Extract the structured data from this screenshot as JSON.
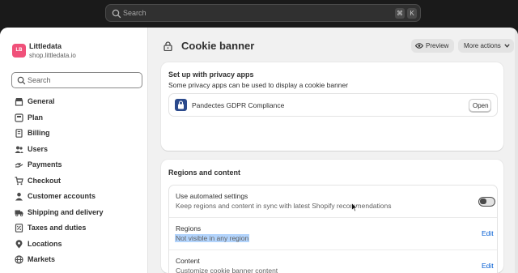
{
  "topbar": {
    "search_placeholder": "Search",
    "shortcut_keys": [
      "⌘",
      "K"
    ]
  },
  "store": {
    "initials": "LB",
    "name": "Littledata",
    "url": "shop.littledata.io",
    "avatar_color": "#f0517a"
  },
  "sidebar": {
    "search_placeholder": "Search",
    "items": [
      {
        "label": "General",
        "icon": "store-icon"
      },
      {
        "label": "Plan",
        "icon": "plan-icon"
      },
      {
        "label": "Billing",
        "icon": "billing-icon"
      },
      {
        "label": "Users",
        "icon": "users-icon"
      },
      {
        "label": "Payments",
        "icon": "payments-icon"
      },
      {
        "label": "Checkout",
        "icon": "checkout-icon"
      },
      {
        "label": "Customer accounts",
        "icon": "person-icon"
      },
      {
        "label": "Shipping and delivery",
        "icon": "truck-icon"
      },
      {
        "label": "Taxes and duties",
        "icon": "taxes-icon"
      },
      {
        "label": "Locations",
        "icon": "location-icon"
      },
      {
        "label": "Markets",
        "icon": "globe-icon"
      }
    ]
  },
  "page": {
    "title": "Cookie banner",
    "preview_label": "Preview",
    "more_actions_label": "More actions"
  },
  "privacy_card": {
    "title": "Set up with privacy apps",
    "subtitle": "Some privacy apps can be used to display a cookie banner",
    "app_name": "Pandectes GDPR Compliance",
    "open_label": "Open"
  },
  "regions_card": {
    "title": "Regions and content",
    "rows": [
      {
        "title": "Use automated settings",
        "subtitle": "Keep regions and content in sync with latest Shopify recommendations",
        "toggle_on": false
      },
      {
        "title": "Regions",
        "subtitle": "Not visible in any region",
        "action": "Edit"
      },
      {
        "title": "Content",
        "subtitle": "Customize cookie banner content",
        "action": "Edit"
      }
    ]
  },
  "colors": {
    "link": "#005bd3",
    "selection": "#b3d4fc",
    "app_icon": "#2b4a8c"
  }
}
